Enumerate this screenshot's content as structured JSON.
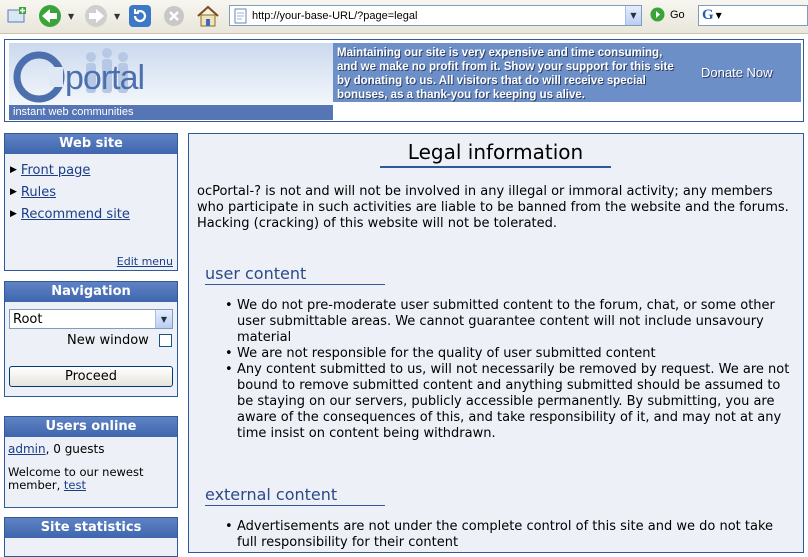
{
  "browser": {
    "address": "http://your-base-URL/?page=legal",
    "go_label": "Go",
    "google_letter": "G"
  },
  "header": {
    "logo_text": "portal",
    "logo_c": "C",
    "tagline": "instant web communities",
    "donate_text": "Maintaining our site is very expensive and time consuming, and we make no profit from it. Show your support for this site by donating to us. All visitors that do will receive special bonuses, as a thank-you for keeping us alive.",
    "donate_button": "Donate Now"
  },
  "sidebar": {
    "website": {
      "title": "Web site",
      "items": [
        "Front page",
        "Rules",
        "Recommend site"
      ],
      "edit_menu": "Edit menu"
    },
    "navigation": {
      "title": "Navigation",
      "select_value": "Root",
      "new_window": "New window",
      "proceed": "Proceed"
    },
    "users_online": {
      "title": "Users online",
      "user": "admin",
      "guests": ", 0 guests",
      "welcome": "Welcome to our newest member, ",
      "newest_member": "test"
    },
    "stats": {
      "title": "Site statistics"
    }
  },
  "main": {
    "title": "Legal information",
    "intro": "ocPortal-? is not and will not be involved in any illegal or immoral activity; any members who participate in such activities are liable to be banned from the website and the forums. Hacking (cracking) of this website will not be tolerated.",
    "sections": [
      {
        "heading": "user content",
        "items": [
          "We do not pre-moderate user submitted content to the forum, chat, or some other user submittable areas. We cannot guarantee content will not include unsavoury material",
          "We are not responsible for the quality of user submitted content",
          "Any content submitted to us, will not necessarily be removed by request. We are not bound to remove submitted content and anything submitted should be assumed to be staying on our servers, publicly accessible permanently. By submitting, you are aware of the consequences of this, and take responsibility of it, and may not at any time insist on content being withdrawn."
        ]
      },
      {
        "heading": "external content",
        "items": [
          "Advertisements are not under the complete control of this site and we do not take full responsibility for their content"
        ]
      }
    ]
  }
}
